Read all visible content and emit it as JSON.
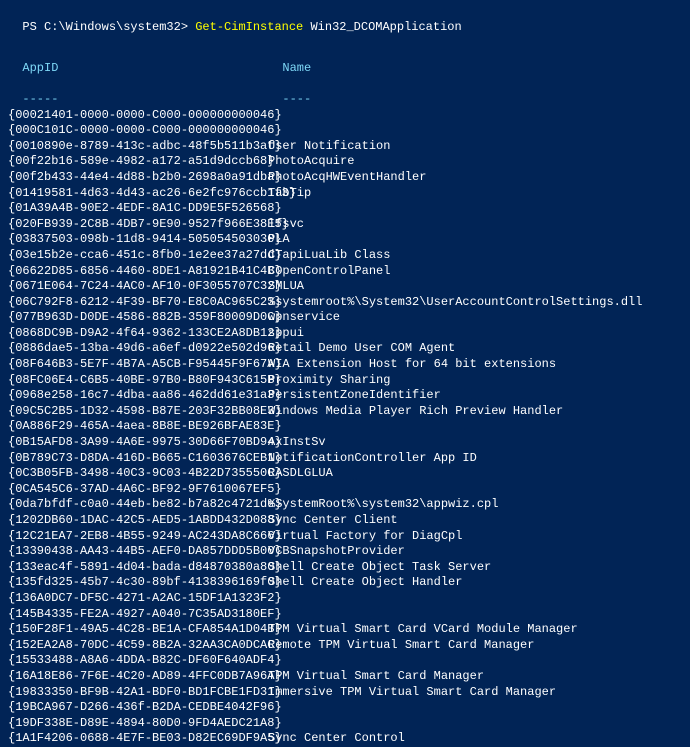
{
  "prompt": {
    "prefix": "PS C:\\Windows\\system32> ",
    "command": "Get-CimInstance",
    "arg": " Win32_DCOMApplication"
  },
  "headers": {
    "appid": "AppID",
    "name": "Name",
    "appid_underline": "-----",
    "name_underline": "----"
  },
  "rows": [
    {
      "appid": "{00021401-0000-0000-C000-000000000046}",
      "name": ""
    },
    {
      "appid": "{000C101C-0000-0000-C000-000000000046}",
      "name": ""
    },
    {
      "appid": "{0010890e-8789-413c-adbc-48f5b511b3af}",
      "name": "User Notification"
    },
    {
      "appid": "{00f22b16-589e-4982-a172-a51d9dccb68}",
      "name": "PhotoAcquire"
    },
    {
      "appid": "{00f2b433-44e4-4d88-b2b0-2698a0a91dba}",
      "name": "PhotoAcqHWEventHandler"
    },
    {
      "appid": "{01419581-4d63-4d43-ac26-6e2fc976ccb1f3}",
      "name": "TabTip"
    },
    {
      "appid": "{01A39A4B-90E2-4EDF-8A1C-DD9E5F526568}",
      "name": ""
    },
    {
      "appid": "{020FB939-2C8B-4DB7-9E90-9527f966E38E5}",
      "name": "lfsvc"
    },
    {
      "appid": "{03837503-098b-11d8-9414-505054503030}",
      "name": "PLA"
    },
    {
      "appid": "{03e15b2e-cca6-451c-8fb0-1e2ee37a27dd}",
      "name": "CTapiLuaLib Class"
    },
    {
      "appid": "{06622D85-6856-4460-8DE1-A81921B41C4B}",
      "name": "COpenControlPanel"
    },
    {
      "appid": "{0671E064-7C24-4AC0-AF10-0F3055707C32}",
      "name": "SMLUA"
    },
    {
      "appid": "{06C792F8-6212-4F39-BF70-E8C0AC965C23}",
      "name": "%systemroot%\\System32\\UserAccountControlSettings.dll"
    },
    {
      "appid": "{077B963D-D0DE-4586-882B-359F80009D0C}",
      "name": "wpnservice"
    },
    {
      "appid": "{0868DC9B-D9A2-4f64-9362-133CE2A8DB12}",
      "name": "sppui"
    },
    {
      "appid": "{0886dae5-13ba-49d6-a6ef-d0922e502d96}",
      "name": "Retail Demo User COM Agent"
    },
    {
      "appid": "{08F646B3-5E7F-4B7A-A5CB-F95445F9F67A}",
      "name": "WIA Extension Host for 64 bit extensions"
    },
    {
      "appid": "{08FC06E4-C6B5-40BE-97B0-B80F943C615B}",
      "name": "Proximity Sharing"
    },
    {
      "appid": "{0968e258-16c7-4dba-aa86-462dd61e31a3}",
      "name": "PersistentZoneIdentifier"
    },
    {
      "appid": "{09C5C2B5-1D32-4598-B87E-203F32BB08E3}",
      "name": "Windows Media Player Rich Preview Handler"
    },
    {
      "appid": "{0A886F29-465A-4aea-8B8E-BE926BFAE83E}",
      "name": ""
    },
    {
      "appid": "{0B15AFD8-3A99-4A6E-9975-30D66F70BD94}",
      "name": "AxInstSv"
    },
    {
      "appid": "{0B789C73-D8DA-416D-B665-C1603676CEB1}",
      "name": "NotificationController App ID"
    },
    {
      "appid": "{0C3B05FB-3498-40C3-9C03-4B22D735550C}",
      "name": "RASDLGLUA"
    },
    {
      "appid": "{0CA545C6-37AD-4A6C-BF92-9F7610067EF5}",
      "name": ""
    },
    {
      "appid": "{0da7bfdf-c0a0-44eb-be82-b7a82c4721de}",
      "name": "%SystemRoot%\\system32\\appwiz.cpl"
    },
    {
      "appid": "{1202DB60-1DAC-42C5-AED5-1ABDD432D088}",
      "name": "Sync Center Client"
    },
    {
      "appid": "{12C21EA7-2EB8-4B55-9249-AC243DA8C666}",
      "name": "Virtual Factory for DiagCpl"
    },
    {
      "appid": "{13390438-AA43-44B5-AEF0-DA857DDD5B00}",
      "name": "VCBSnapshotProvider"
    },
    {
      "appid": "{133eac4f-5891-4d04-bada-d84870380a80}",
      "name": "Shell Create Object Task Server"
    },
    {
      "appid": "{135fd325-45b7-4c30-89bf-4138396169f0}",
      "name": "Shell Create Object Handler"
    },
    {
      "appid": "{136A0DC7-DF5C-4271-A2AC-15DF1A1323F2}",
      "name": ""
    },
    {
      "appid": "{145B4335-FE2A-4927-A040-7C35AD3180EF}",
      "name": ""
    },
    {
      "appid": "{150F28F1-49A5-4C28-BE1A-CFA854A1D04B}",
      "name": "TPM Virtual Smart Card VCard Module Manager"
    },
    {
      "appid": "{152EA2A8-70DC-4C59-8B2A-32AA3CA0DCAC}",
      "name": "Remote TPM Virtual Smart Card Manager"
    },
    {
      "appid": "{15533488-A8A6-4DDA-B82C-DF60F640ADF4}",
      "name": ""
    },
    {
      "appid": "{16A18E86-7F6E-4C20-AD89-4FFC0DB7A96A}",
      "name": "TPM Virtual Smart Card Manager"
    },
    {
      "appid": "{19833350-BF9B-42A1-BDF0-BD1FCBE1FD31}",
      "name": "Immersive TPM Virtual Smart Card Manager"
    },
    {
      "appid": "{19BCA967-D266-436f-B2DA-CEDBE4042F96}",
      "name": ""
    },
    {
      "appid": "{19DF338E-D89E-4894-80D0-9FD4AEDC21A8}",
      "name": ""
    },
    {
      "appid": "{1A1F4206-0688-4E7F-BE03-D82EC69DF9A5}",
      "name": "Sync Center Control"
    }
  ]
}
